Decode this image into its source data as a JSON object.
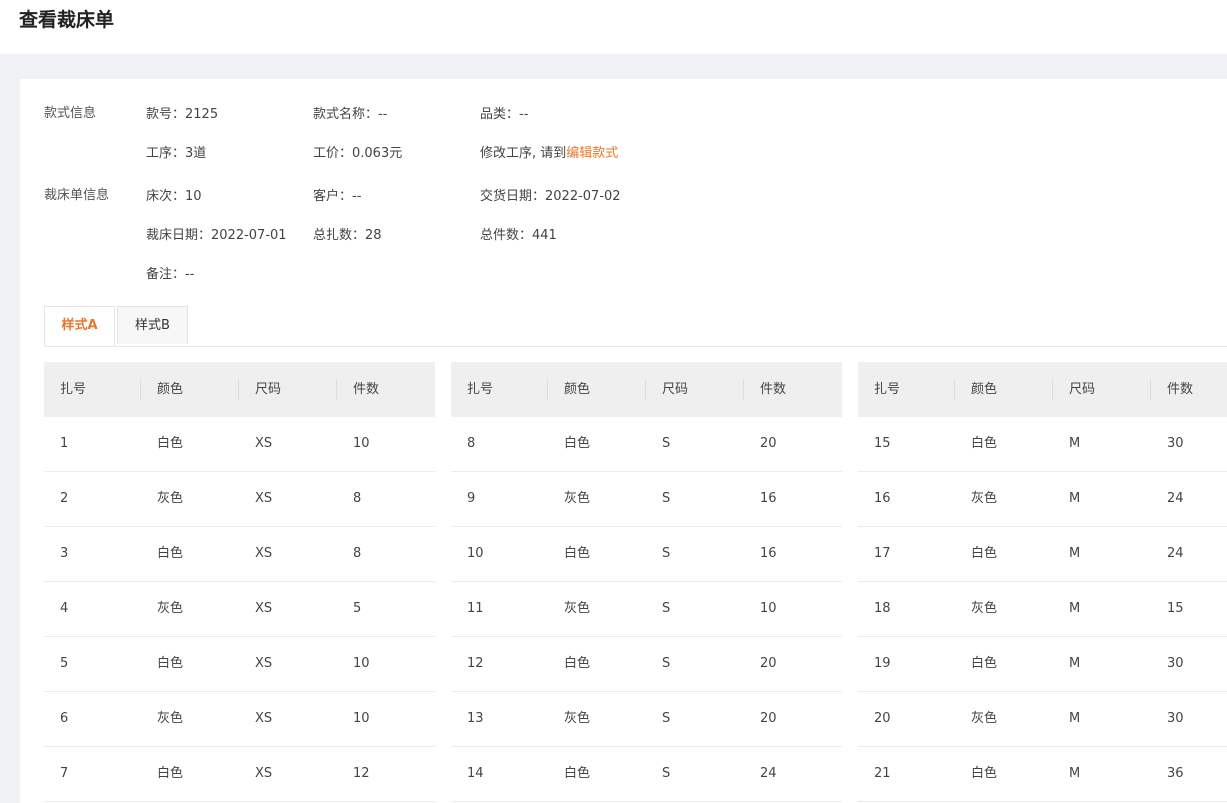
{
  "page": {
    "title": "查看裁床单"
  },
  "style_info": {
    "label": "款式信息",
    "style_no": "款号：2125",
    "style_name": "款式名称：--",
    "category": "品类：--",
    "process": "工序：3道",
    "unit_price": "工价：0.063元",
    "edit_hint": "修改工序, 请到",
    "edit_link": "编辑款式"
  },
  "cutting_info": {
    "label": "裁床单信息",
    "bed_no": "床次：10",
    "customer": "客户：--",
    "delivery_date": "交货日期：2022-07-02",
    "cutting_date": "裁床日期：2022-07-01",
    "bundle_total": "总扎数：28",
    "piece_total": "总件数：441",
    "remark": "备注：--"
  },
  "tabs": [
    {
      "label": "样式A",
      "active": true
    },
    {
      "label": "样式B",
      "active": false
    }
  ],
  "table": {
    "headers": [
      "扎号",
      "颜色",
      "尺码",
      "件数"
    ],
    "groups": [
      {
        "rows": [
          [
            "1",
            "白色",
            "XS",
            "10"
          ],
          [
            "2",
            "灰色",
            "XS",
            "8"
          ],
          [
            "3",
            "白色",
            "XS",
            "8"
          ],
          [
            "4",
            "灰色",
            "XS",
            "5"
          ],
          [
            "5",
            "白色",
            "XS",
            "10"
          ],
          [
            "6",
            "灰色",
            "XS",
            "10"
          ],
          [
            "7",
            "白色",
            "XS",
            "12"
          ]
        ]
      },
      {
        "rows": [
          [
            "8",
            "白色",
            "S",
            "20"
          ],
          [
            "9",
            "灰色",
            "S",
            "16"
          ],
          [
            "10",
            "白色",
            "S",
            "16"
          ],
          [
            "11",
            "灰色",
            "S",
            "10"
          ],
          [
            "12",
            "白色",
            "S",
            "20"
          ],
          [
            "13",
            "灰色",
            "S",
            "20"
          ],
          [
            "14",
            "白色",
            "S",
            "24"
          ]
        ]
      },
      {
        "rows": [
          [
            "15",
            "白色",
            "M",
            "30"
          ],
          [
            "16",
            "灰色",
            "M",
            "24"
          ],
          [
            "17",
            "白色",
            "M",
            "24"
          ],
          [
            "18",
            "灰色",
            "M",
            "15"
          ],
          [
            "19",
            "白色",
            "M",
            "30"
          ],
          [
            "20",
            "灰色",
            "M",
            "30"
          ],
          [
            "21",
            "白色",
            "M",
            "36"
          ]
        ]
      }
    ]
  },
  "colors": {
    "accent": "#e8772d",
    "header_bg": "#efefef",
    "page_bg": "#f0f2f5"
  }
}
